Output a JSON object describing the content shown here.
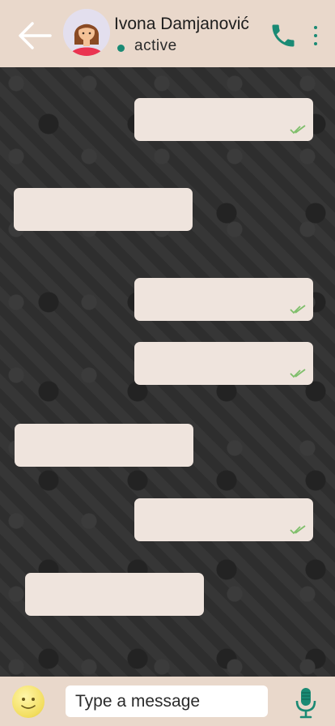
{
  "header": {
    "contact_name": "Ivona Damjanović",
    "status": "active",
    "colors": {
      "bar": "#e9d8cb",
      "accent": "#1a8a74"
    },
    "icons": [
      "back-arrow-icon",
      "phone-icon",
      "more-vert-icon"
    ]
  },
  "messages": [
    {
      "direction": "outgoing",
      "text": "",
      "status": "read"
    },
    {
      "direction": "incoming",
      "text": ""
    },
    {
      "direction": "outgoing",
      "text": "",
      "status": "read"
    },
    {
      "direction": "outgoing",
      "text": "",
      "status": "read"
    },
    {
      "direction": "incoming",
      "text": ""
    },
    {
      "direction": "outgoing",
      "text": "",
      "status": "read"
    },
    {
      "direction": "incoming",
      "text": ""
    }
  ],
  "composer": {
    "placeholder": "Type a message",
    "value": "",
    "icons": [
      "emoji-icon",
      "microphone-icon"
    ]
  }
}
